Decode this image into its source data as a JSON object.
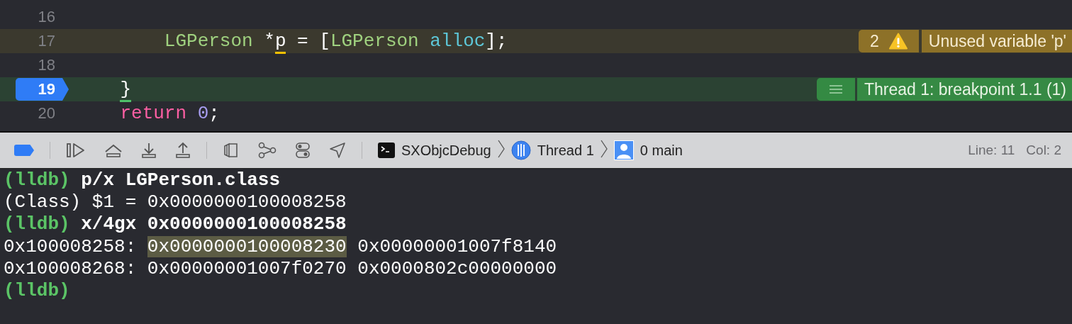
{
  "editor": {
    "lines": [
      {
        "number": "16",
        "breakpoint": false,
        "current": false
      },
      {
        "number": "17",
        "breakpoint": false,
        "current": false,
        "tokens": [
          {
            "text": "        LGPerson",
            "kind": "type",
            "underlined": false
          },
          {
            "text": " *",
            "kind": "plain",
            "underlined": false
          },
          {
            "text": "p",
            "kind": "plain",
            "underlined": true
          },
          {
            "text": " = [",
            "kind": "plain",
            "underlined": false
          },
          {
            "text": "LGPerson ",
            "kind": "type",
            "underlined": false
          },
          {
            "text": "alloc",
            "kind": "method",
            "underlined": false
          },
          {
            "text": "];",
            "kind": "plain",
            "underlined": false
          }
        ],
        "annotation": {
          "kind": "warning",
          "count": "2",
          "message": "Unused variable 'p'"
        }
      },
      {
        "number": "18",
        "breakpoint": false,
        "current": false
      },
      {
        "number": "19",
        "breakpoint": true,
        "current": true,
        "tokens": [
          {
            "text": "    }",
            "kind": "plain",
            "underlined": true
          }
        ],
        "annotation": {
          "kind": "breakpoint",
          "message": "Thread 1: breakpoint 1.1 (1)"
        }
      },
      {
        "number": "20",
        "breakpoint": false,
        "current": false,
        "tokens": [
          {
            "text": "    return ",
            "kind": "keyword",
            "underlined": false
          },
          {
            "text": "0",
            "kind": "number",
            "underlined": false
          },
          {
            "text": ";",
            "kind": "plain",
            "underlined": false
          }
        ]
      }
    ]
  },
  "debug_bar": {
    "breakpoints_active": true,
    "breadcrumbs": [
      {
        "kind": "terminal",
        "label": "SXObjcDebug"
      },
      {
        "kind": "thread",
        "label": "Thread 1"
      },
      {
        "kind": "frame",
        "label": "0 main"
      }
    ],
    "line": "Line: 11",
    "column": "Col: 2"
  },
  "console": {
    "lines": [
      {
        "segments": [
          {
            "text": "(lldb)",
            "kind": "prompt",
            "highlighted": false
          },
          {
            "text": "p/x LGPerson.class",
            "kind": "command",
            "highlighted": false
          }
        ]
      },
      {
        "segments": [
          {
            "text": "(Class) $1 = 0x0000000100008258",
            "kind": "output",
            "highlighted": false
          }
        ]
      },
      {
        "segments": [
          {
            "text": "(lldb)",
            "kind": "prompt",
            "highlighted": false
          },
          {
            "text": "x/4gx 0x0000000100008258",
            "kind": "command",
            "highlighted": false
          }
        ]
      },
      {
        "segments": [
          {
            "text": "0x100008258:",
            "kind": "output",
            "highlighted": false
          },
          {
            "text": "0x0000000100008230",
            "kind": "output",
            "highlighted": true
          },
          {
            "text": "0x00000001007f8140",
            "kind": "output",
            "highlighted": false
          }
        ]
      },
      {
        "segments": [
          {
            "text": "0x100008268:",
            "kind": "output",
            "highlighted": false
          },
          {
            "text": "0x00000001007f0270",
            "kind": "output",
            "highlighted": false
          },
          {
            "text": "0x0000802c00000000",
            "kind": "output",
            "highlighted": false
          }
        ]
      },
      {
        "segments": [
          {
            "text": "(lldb)",
            "kind": "prompt",
            "highlighted": false
          }
        ]
      }
    ]
  }
}
